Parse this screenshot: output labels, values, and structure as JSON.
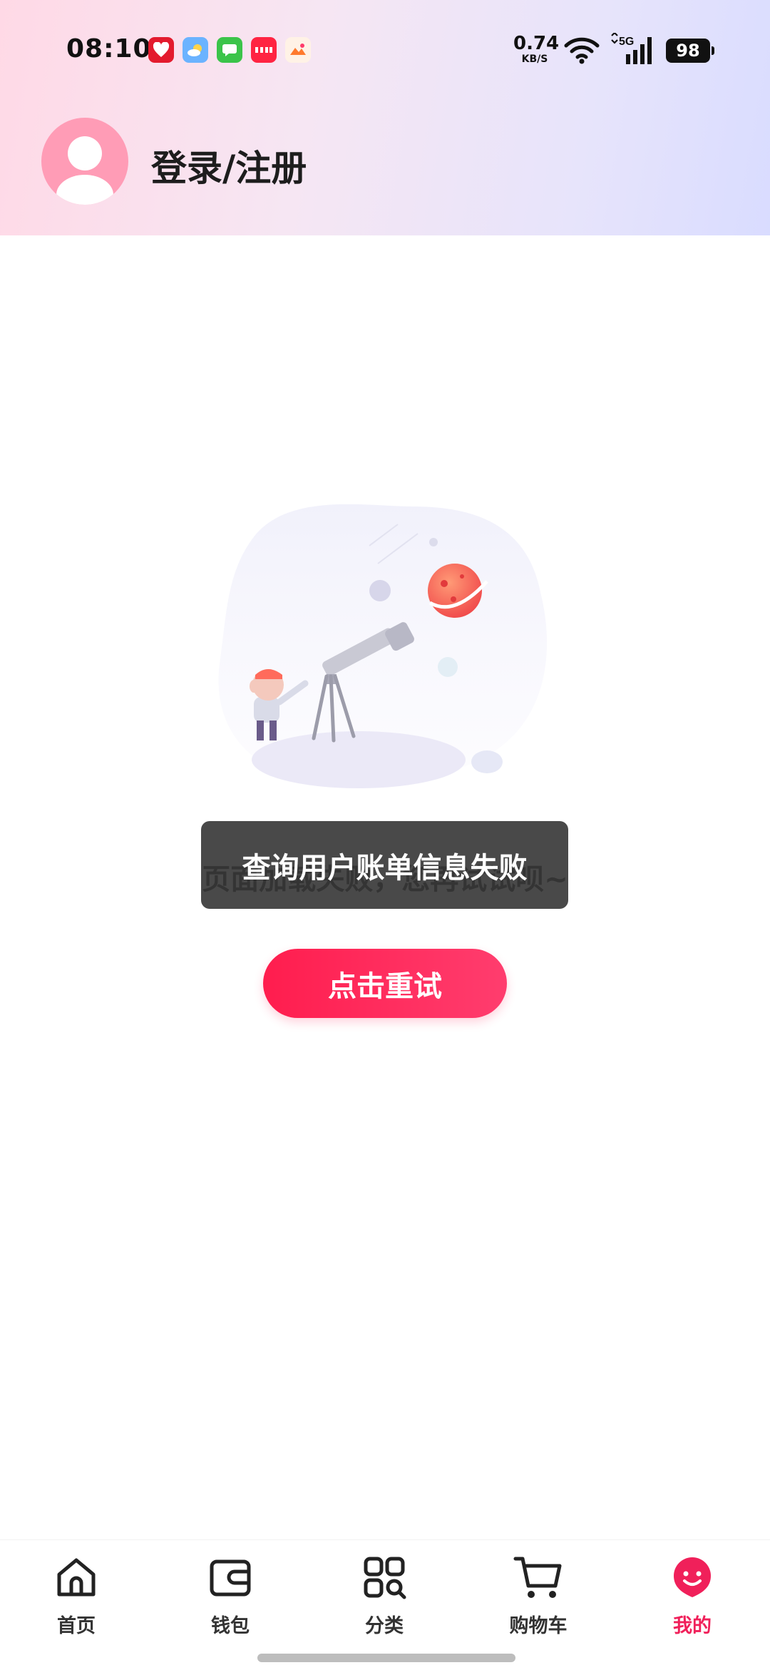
{
  "status_bar": {
    "time": "08:10",
    "net_speed_value": "0.74",
    "net_speed_unit": "KB/S",
    "network_label": "5G",
    "battery": "98"
  },
  "notification_icons": [
    "app-heart-icon",
    "weather-icon",
    "messages-icon",
    "xiaohongshu-icon",
    "gallery-icon"
  ],
  "header": {
    "login_label": "登录/注册"
  },
  "main": {
    "error_message": "页面加载失败，您再试试呗~",
    "retry_label": "点击重试"
  },
  "toast": {
    "text": "查询用户账单信息失败"
  },
  "tabbar": {
    "items": [
      {
        "label": "首页",
        "icon": "home-icon"
      },
      {
        "label": "钱包",
        "icon": "wallet-icon"
      },
      {
        "label": "分类",
        "icon": "category-icon"
      },
      {
        "label": "购物车",
        "icon": "cart-icon"
      },
      {
        "label": "我的",
        "icon": "profile-icon",
        "active": true
      }
    ]
  },
  "colors": {
    "accent": "#f0205a",
    "button_gradient_start": "#ff1d4e",
    "button_gradient_end": "#ff3d6e",
    "toast_bg": "#303030"
  }
}
